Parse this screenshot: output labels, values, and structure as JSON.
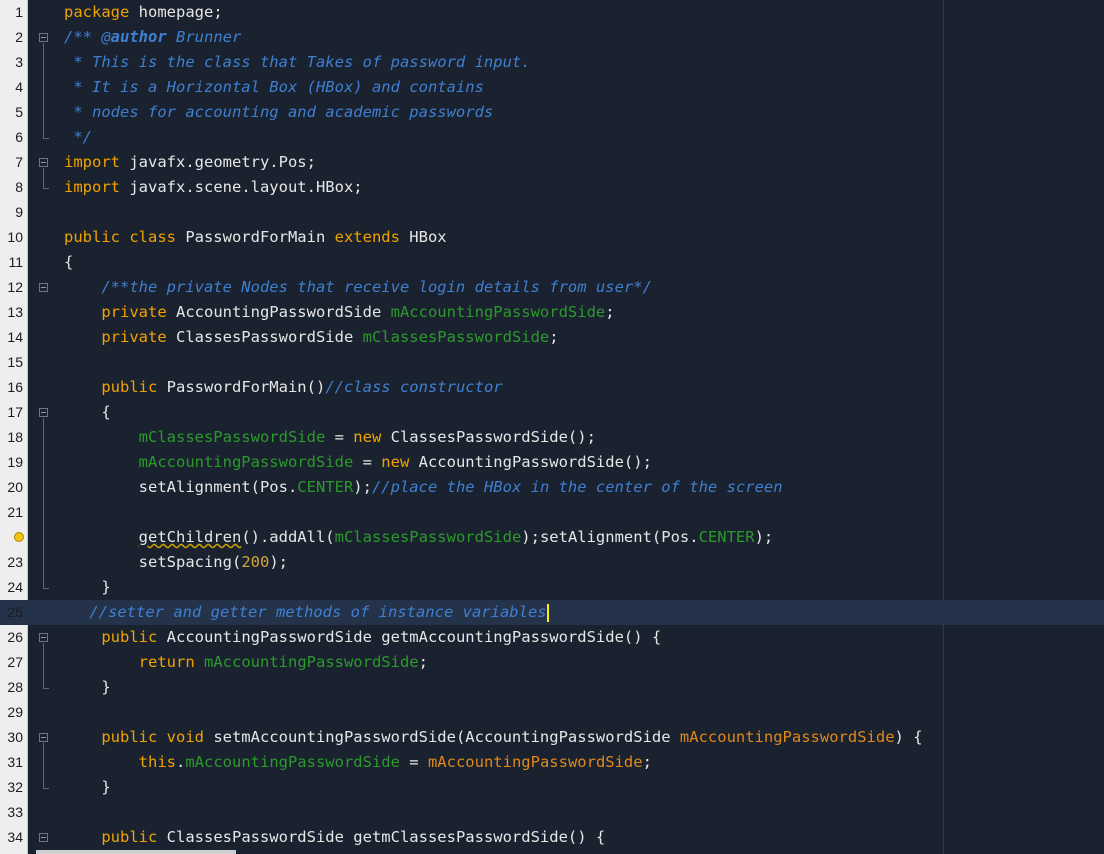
{
  "editor": {
    "language": "java",
    "current_line": 25,
    "lines": [
      {
        "n": "1",
        "segs": [
          [
            "kw",
            "package"
          ],
          [
            "pl",
            " homepage;"
          ]
        ]
      },
      {
        "n": "2",
        "segs": [
          [
            "cm",
            "/** @"
          ],
          [
            "cmb",
            "author"
          ],
          [
            "cm",
            " Brunner"
          ]
        ]
      },
      {
        "n": "3",
        "segs": [
          [
            "cm",
            " * This is the class that Takes of password input."
          ]
        ]
      },
      {
        "n": "4",
        "segs": [
          [
            "cm",
            " * It is a Horizontal Box (HBox) and contains"
          ]
        ]
      },
      {
        "n": "5",
        "segs": [
          [
            "cm",
            " * nodes for accounting and academic passwords"
          ]
        ]
      },
      {
        "n": "6",
        "segs": [
          [
            "cm",
            " */"
          ]
        ]
      },
      {
        "n": "7",
        "segs": [
          [
            "kw",
            "import"
          ],
          [
            "pl",
            " javafx.geometry.Pos;"
          ]
        ]
      },
      {
        "n": "8",
        "segs": [
          [
            "kw",
            "import"
          ],
          [
            "pl",
            " javafx.scene.layout.HBox;"
          ]
        ]
      },
      {
        "n": "9",
        "segs": []
      },
      {
        "n": "10",
        "segs": [
          [
            "kw",
            "public class"
          ],
          [
            "pl",
            " PasswordForMain "
          ],
          [
            "kw",
            "extends"
          ],
          [
            "pl",
            " HBox"
          ]
        ]
      },
      {
        "n": "11",
        "segs": [
          [
            "pl",
            "{"
          ]
        ]
      },
      {
        "n": "12",
        "segs": [
          [
            "pl",
            "    "
          ],
          [
            "cm",
            "/**the private Nodes that receive login details from user*/"
          ]
        ]
      },
      {
        "n": "13",
        "segs": [
          [
            "pl",
            "    "
          ],
          [
            "kw",
            "private"
          ],
          [
            "pl",
            " AccountingPasswordSide "
          ],
          [
            "fld",
            "mAccountingPasswordSide"
          ],
          [
            "pl",
            ";"
          ]
        ]
      },
      {
        "n": "14",
        "segs": [
          [
            "pl",
            "    "
          ],
          [
            "kw",
            "private"
          ],
          [
            "pl",
            " ClassesPasswordSide "
          ],
          [
            "fld",
            "mClassesPasswordSide"
          ],
          [
            "pl",
            ";"
          ]
        ]
      },
      {
        "n": "15",
        "segs": []
      },
      {
        "n": "16",
        "segs": [
          [
            "pl",
            "    "
          ],
          [
            "kw",
            "public"
          ],
          [
            "pl",
            " PasswordForMain()"
          ],
          [
            "cm",
            "//class constructor"
          ]
        ]
      },
      {
        "n": "17",
        "segs": [
          [
            "pl",
            "    {"
          ]
        ]
      },
      {
        "n": "18",
        "segs": [
          [
            "pl",
            "        "
          ],
          [
            "fld",
            "mClassesPasswordSide"
          ],
          [
            "pl",
            " = "
          ],
          [
            "kw",
            "new"
          ],
          [
            "pl",
            " ClassesPasswordSide();"
          ]
        ]
      },
      {
        "n": "19",
        "segs": [
          [
            "pl",
            "        "
          ],
          [
            "fld",
            "mAccountingPasswordSide"
          ],
          [
            "pl",
            " = "
          ],
          [
            "kw",
            "new"
          ],
          [
            "pl",
            " AccountingPasswordSide();"
          ]
        ]
      },
      {
        "n": "20",
        "segs": [
          [
            "pl",
            "        setAlignment(Pos."
          ],
          [
            "fld",
            "CENTER"
          ],
          [
            "pl",
            ");"
          ],
          [
            "cm",
            "//place the HBox in the center of the screen"
          ]
        ]
      },
      {
        "n": "21",
        "segs": []
      },
      {
        "n": "",
        "segs": [
          [
            "pl",
            "        "
          ],
          [
            "squiggle",
            "getChildren"
          ],
          [
            "pl",
            "().addAll("
          ],
          [
            "fld",
            "mClassesPasswordSide"
          ],
          [
            "pl",
            ");setAlignment(Pos."
          ],
          [
            "fld",
            "CENTER"
          ],
          [
            "pl",
            ");"
          ]
        ]
      },
      {
        "n": "23",
        "segs": [
          [
            "pl",
            "        setSpacing("
          ],
          [
            "num",
            "200"
          ],
          [
            "pl",
            ");"
          ]
        ]
      },
      {
        "n": "24",
        "segs": [
          [
            "pl",
            "    }"
          ]
        ]
      },
      {
        "n": "25",
        "segs": [
          [
            "pl",
            " "
          ],
          [
            "cm",
            "//setter and getter methods of instance variables"
          ]
        ]
      },
      {
        "n": "26",
        "segs": [
          [
            "pl",
            "    "
          ],
          [
            "kw",
            "public"
          ],
          [
            "pl",
            " AccountingPasswordSide getmAccountingPasswordSide() {"
          ]
        ]
      },
      {
        "n": "27",
        "segs": [
          [
            "pl",
            "        "
          ],
          [
            "kw",
            "return"
          ],
          [
            "pl",
            " "
          ],
          [
            "fld",
            "mAccountingPasswordSide"
          ],
          [
            "pl",
            ";"
          ]
        ]
      },
      {
        "n": "28",
        "segs": [
          [
            "pl",
            "    }"
          ]
        ]
      },
      {
        "n": "29",
        "segs": []
      },
      {
        "n": "30",
        "segs": [
          [
            "pl",
            "    "
          ],
          [
            "kw",
            "public void"
          ],
          [
            "pl",
            " setmAccountingPasswordSide(AccountingPasswordSide "
          ],
          [
            "par",
            "mAccountingPasswordSide"
          ],
          [
            "pl",
            ") {"
          ]
        ]
      },
      {
        "n": "31",
        "segs": [
          [
            "pl",
            "        "
          ],
          [
            "kw",
            "this"
          ],
          [
            "pl",
            "."
          ],
          [
            "fld",
            "mAccountingPasswordSide"
          ],
          [
            "pl",
            " = "
          ],
          [
            "par",
            "mAccountingPasswordSide"
          ],
          [
            "pl",
            ";"
          ]
        ]
      },
      {
        "n": "32",
        "segs": [
          [
            "pl",
            "    }"
          ]
        ]
      },
      {
        "n": "33",
        "segs": []
      },
      {
        "n": "34",
        "segs": [
          [
            "pl",
            "    "
          ],
          [
            "kw",
            "public"
          ],
          [
            "pl",
            " ClassesPasswordSide getmClassesPasswordSide() {"
          ]
        ]
      }
    ]
  },
  "gutter": {
    "hint_icon": "lightbulb-icon",
    "hint_line": 22,
    "fold_markers": [
      2,
      7,
      12,
      17,
      26,
      30,
      34
    ]
  },
  "colors": {
    "background": "#1a2230",
    "keyword": "#f0a200",
    "comment": "#3f7fd1",
    "field": "#2b9a2b",
    "parameter": "#e0881a",
    "number": "#d5a23a",
    "caret": "#ffee00"
  }
}
